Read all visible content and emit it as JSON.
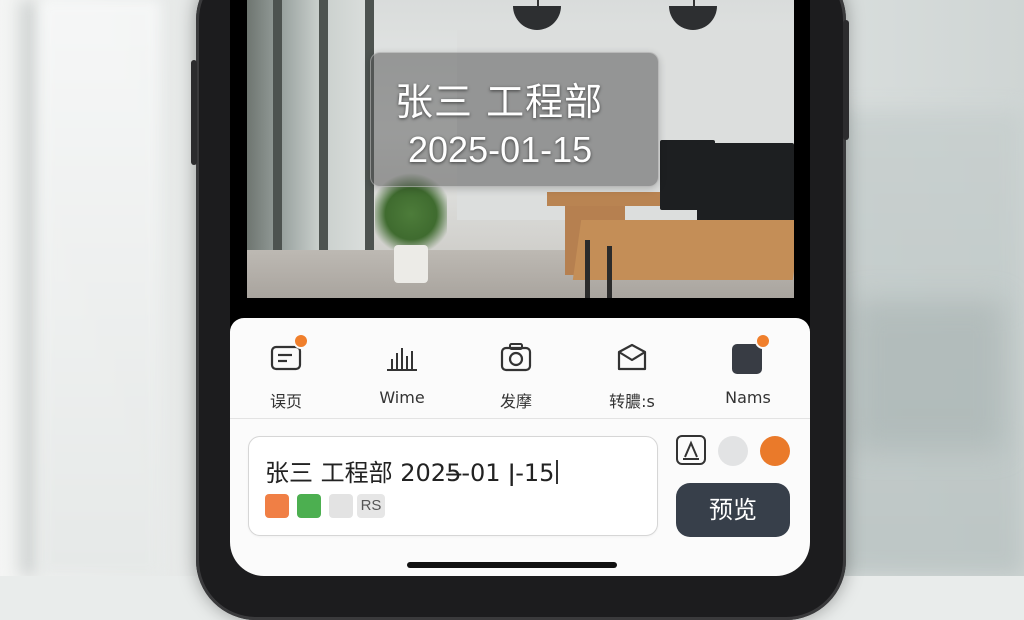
{
  "camera": {
    "overlay_name": "张三 工程部",
    "overlay_date": "2025-01-15"
  },
  "toolbar": {
    "items": [
      {
        "label": "误页",
        "icon": "message-icon",
        "badge": true
      },
      {
        "label": "Wime",
        "icon": "bar-chart-icon",
        "badge": false
      },
      {
        "label": "发摩",
        "icon": "camera-icon",
        "badge": false
      },
      {
        "label": "转膿:s",
        "icon": "box-icon",
        "badge": false
      },
      {
        "label": "Nams",
        "icon": "square-icon",
        "badge": true
      }
    ]
  },
  "editor": {
    "text_before_caret": "张三 工程部 2025̶-01 ǀ-15",
    "chip_label": "RS",
    "swatches": [
      "#f07f45",
      "#4caf50",
      "#e3e3e3"
    ]
  },
  "controls": {
    "preview_label": "预览",
    "color_options": [
      "#e2e3e4",
      "#ea7a2a"
    ]
  },
  "colors": {
    "accent": "#f07f2c",
    "button_dark": "#373f4a"
  }
}
